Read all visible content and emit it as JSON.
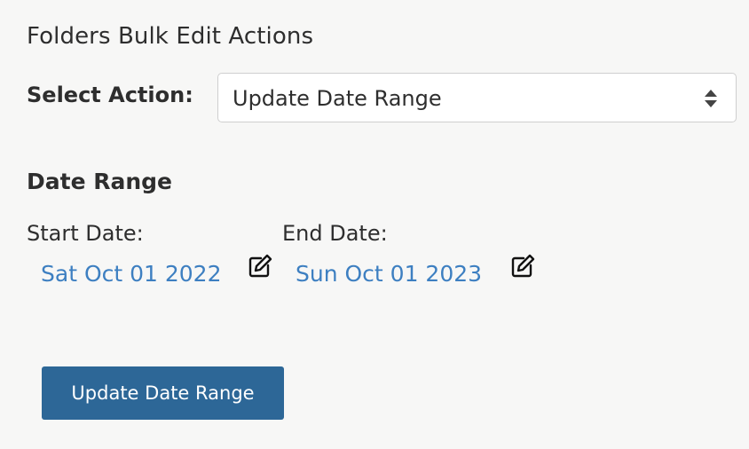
{
  "panel": {
    "title": "Folders Bulk Edit Actions"
  },
  "action": {
    "label": "Select Action:",
    "selected": "Update Date Range"
  },
  "date_range": {
    "title": "Date Range",
    "start": {
      "label": "Start Date:",
      "value": "Sat Oct 01 2022",
      "icon": "edit-icon"
    },
    "end": {
      "label": "End Date:",
      "value": "Sun Oct 01 2023",
      "icon": "edit-icon"
    }
  },
  "submit": {
    "label": "Update Date Range"
  },
  "colors": {
    "link": "#3d7fc1",
    "button": "#2d6797",
    "background": "#f7f7f6"
  }
}
